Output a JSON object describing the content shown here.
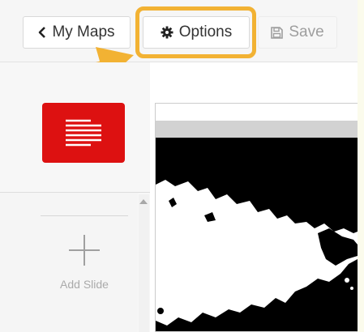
{
  "toolbar": {
    "my_maps_label": "My Maps",
    "options_label": "Options",
    "save_label": "Save"
  },
  "annotation": {
    "side_label_fragment": "s",
    "highlight_color": "#f2b233"
  },
  "sidebar": {
    "add_slide_label": "Add Slide",
    "slide_thumb_color": "#dd1111"
  },
  "icons": {
    "back": "chevron-left-icon",
    "options": "gear-icon",
    "save": "floppy-disk-icon",
    "slide": "text-lines-icon",
    "add": "plus-icon"
  },
  "colors": {
    "accent_blue": "#1f7fb5",
    "arrow": "#f2b233",
    "map_background": "#000000"
  }
}
